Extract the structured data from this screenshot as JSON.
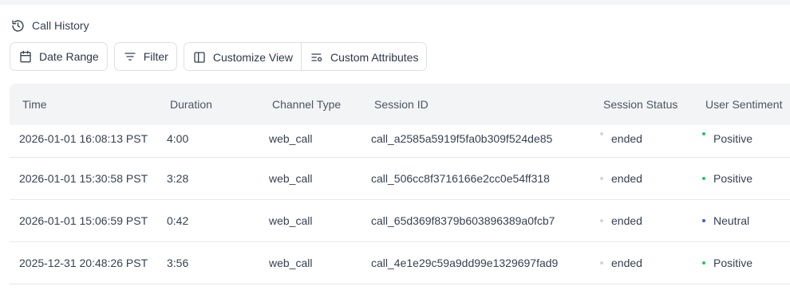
{
  "header": {
    "title": "Call History",
    "icon": "history-icon"
  },
  "toolbar": {
    "date_range": "Date Range",
    "filter": "Filter",
    "customize_view": "Customize View",
    "custom_attributes": "Custom Attributes"
  },
  "table": {
    "columns": [
      "Time",
      "Duration",
      "Channel Type",
      "Session ID",
      "Session Status",
      "User Sentiment"
    ],
    "rows": [
      {
        "time": "2026-01-01 16:08:13 PST",
        "duration": "4:00",
        "channel": "web_call",
        "session_id": "call_a2585a5919f5fa0b309f524de85",
        "status": "ended",
        "sentiment": "Positive"
      },
      {
        "time": "2026-01-01 15:30:58 PST",
        "duration": "3:28",
        "channel": "web_call",
        "session_id": "call_506cc8f3716166e2cc0e54ff318",
        "status": "ended",
        "sentiment": "Positive"
      },
      {
        "time": "2026-01-01 15:06:59 PST",
        "duration": "0:42",
        "channel": "web_call",
        "session_id": "call_65d369f8379b603896389a0fcb7",
        "status": "ended",
        "sentiment": "Neutral"
      },
      {
        "time": "2025-12-31 20:48:26 PST",
        "duration": "3:56",
        "channel": "web_call",
        "session_id": "call_4e1e29c59a9dd99e1329697fad9",
        "status": "ended",
        "sentiment": "Positive"
      }
    ]
  },
  "colors": {
    "status_ended": "#d1d5db",
    "sentiment_positive": "#22c55e",
    "sentiment_neutral": "#3b5bdb"
  }
}
